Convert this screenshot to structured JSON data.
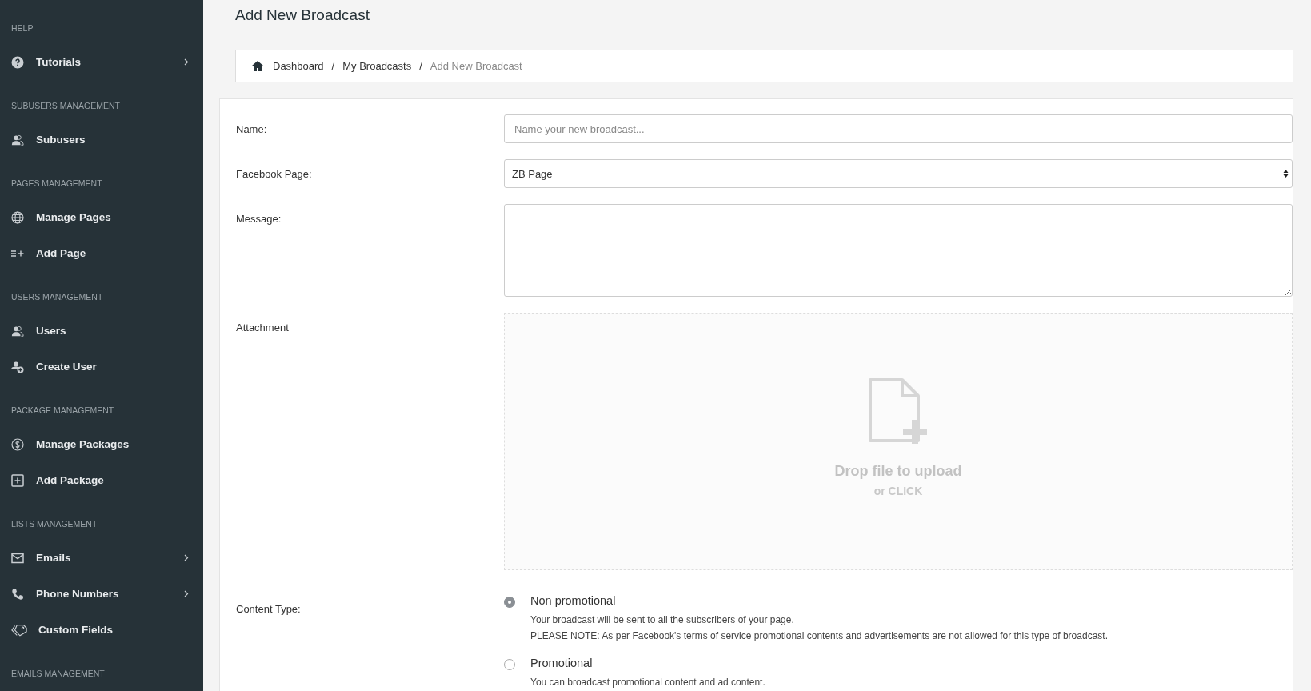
{
  "sidebar": {
    "sections": [
      {
        "header": "HELP",
        "items": [
          {
            "label": "Tutorials",
            "has_submenu": true
          }
        ]
      },
      {
        "header": "SUBUSERS MANAGEMENT",
        "items": [
          {
            "label": "Subusers",
            "has_submenu": false
          }
        ]
      },
      {
        "header": "PAGES MANAGEMENT",
        "items": [
          {
            "label": "Manage Pages",
            "has_submenu": false
          },
          {
            "label": "Add Page",
            "has_submenu": false
          }
        ]
      },
      {
        "header": "USERS MANAGEMENT",
        "items": [
          {
            "label": "Users",
            "has_submenu": false
          },
          {
            "label": "Create User",
            "has_submenu": false
          }
        ]
      },
      {
        "header": "PACKAGE MANAGEMENT",
        "items": [
          {
            "label": "Manage Packages",
            "has_submenu": false
          },
          {
            "label": "Add Package",
            "has_submenu": false
          }
        ]
      },
      {
        "header": "LISTS MANAGEMENT",
        "items": [
          {
            "label": "Emails",
            "has_submenu": true
          },
          {
            "label": "Phone Numbers",
            "has_submenu": true
          },
          {
            "label": "Custom Fields",
            "has_submenu": false
          }
        ]
      },
      {
        "header": "EMAILS MANAGEMENT"
      }
    ]
  },
  "page_title": "Add New Broadcast",
  "breadcrumb": [
    {
      "label": "Dashboard",
      "current": false
    },
    {
      "label": "My Broadcasts",
      "current": false
    },
    {
      "label": "Add New Broadcast",
      "current": true
    }
  ],
  "breadcrumb_separator": "/",
  "form": {
    "name": {
      "label": "Name:",
      "placeholder": "Name your new broadcast..."
    },
    "facebook_page": {
      "label": "Facebook Page:",
      "value": "ZB Page"
    },
    "message": {
      "label": "Message:"
    },
    "attachment": {
      "label": "Attachment",
      "drop_text": "Drop file to upload",
      "drop_subtext": "or CLICK"
    },
    "content_type": {
      "label": "Content Type:",
      "options": [
        {
          "title": "Non promotional",
          "selected": true,
          "description": [
            "Your broadcast will be sent to all the subscribers of your page.",
            "PLEASE NOTE: As per Facebook's terms of service promotional contents and advertisements are not allowed for this type of broadcast."
          ]
        },
        {
          "title": "Promotional",
          "selected": false,
          "description": [
            "You can broadcast promotional content and ad content."
          ]
        }
      ]
    }
  }
}
